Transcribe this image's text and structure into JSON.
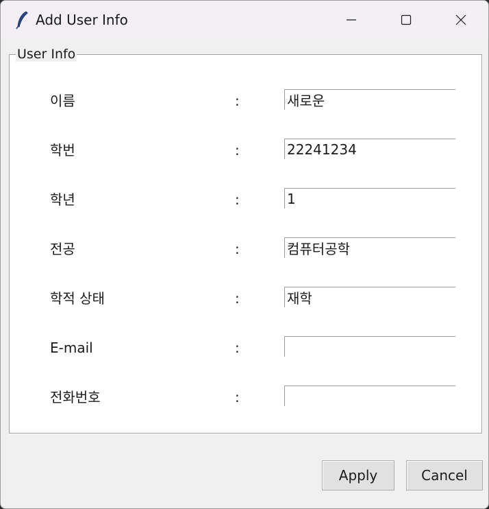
{
  "window": {
    "title": "Add User Info",
    "app_icon": "feather-icon",
    "controls": [
      "minimize-icon",
      "maximize-icon",
      "close-icon"
    ]
  },
  "frame": {
    "legend": "User Info"
  },
  "form": {
    "separator": ":",
    "rows": [
      {
        "label": "이름",
        "value": "새로운"
      },
      {
        "label": "학번",
        "value": "22241234"
      },
      {
        "label": "학년",
        "value": "1"
      },
      {
        "label": "전공",
        "value": "컴퓨터공학"
      },
      {
        "label": "학적 상태",
        "value": "재학"
      },
      {
        "label": "E-mail",
        "value": ""
      },
      {
        "label": "전화번호",
        "value": ""
      }
    ]
  },
  "buttons": {
    "apply": "Apply",
    "cancel": "Cancel"
  }
}
